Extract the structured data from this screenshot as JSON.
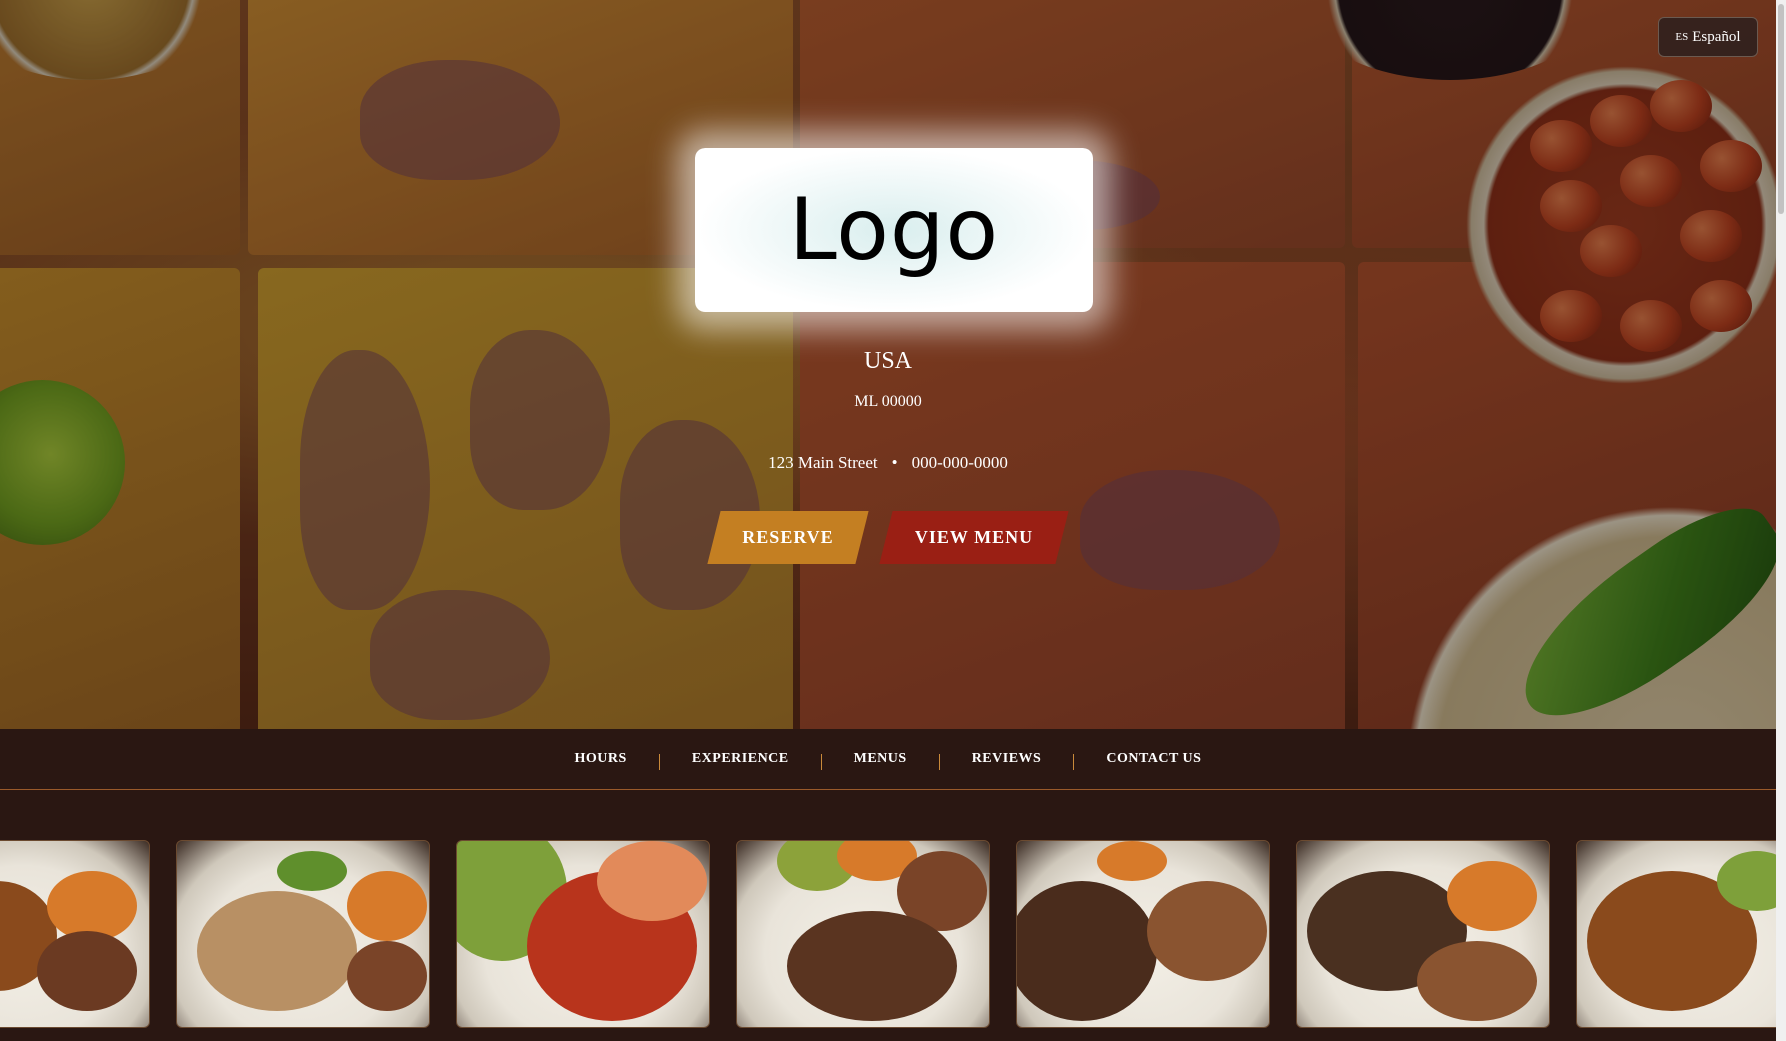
{
  "language": {
    "code": "ES",
    "label": "Español"
  },
  "logo": {
    "text": "Logo"
  },
  "location": {
    "country": "USA",
    "region_zip": "ML 00000",
    "address": "123 Main Street",
    "separator": "•",
    "phone": "000-000-0000"
  },
  "cta": {
    "reserve": "RESERVE",
    "view_menu": "VIEW MENU"
  },
  "nav": {
    "items": [
      "HOURS",
      "EXPERIENCE",
      "MENUS",
      "REVIEWS",
      "CONTACT US"
    ]
  },
  "colors": {
    "reserve": "#c47f22",
    "view_menu": "#9a1f14",
    "nav_bg": "#2a1712",
    "nav_separator": "#c98a3a"
  }
}
